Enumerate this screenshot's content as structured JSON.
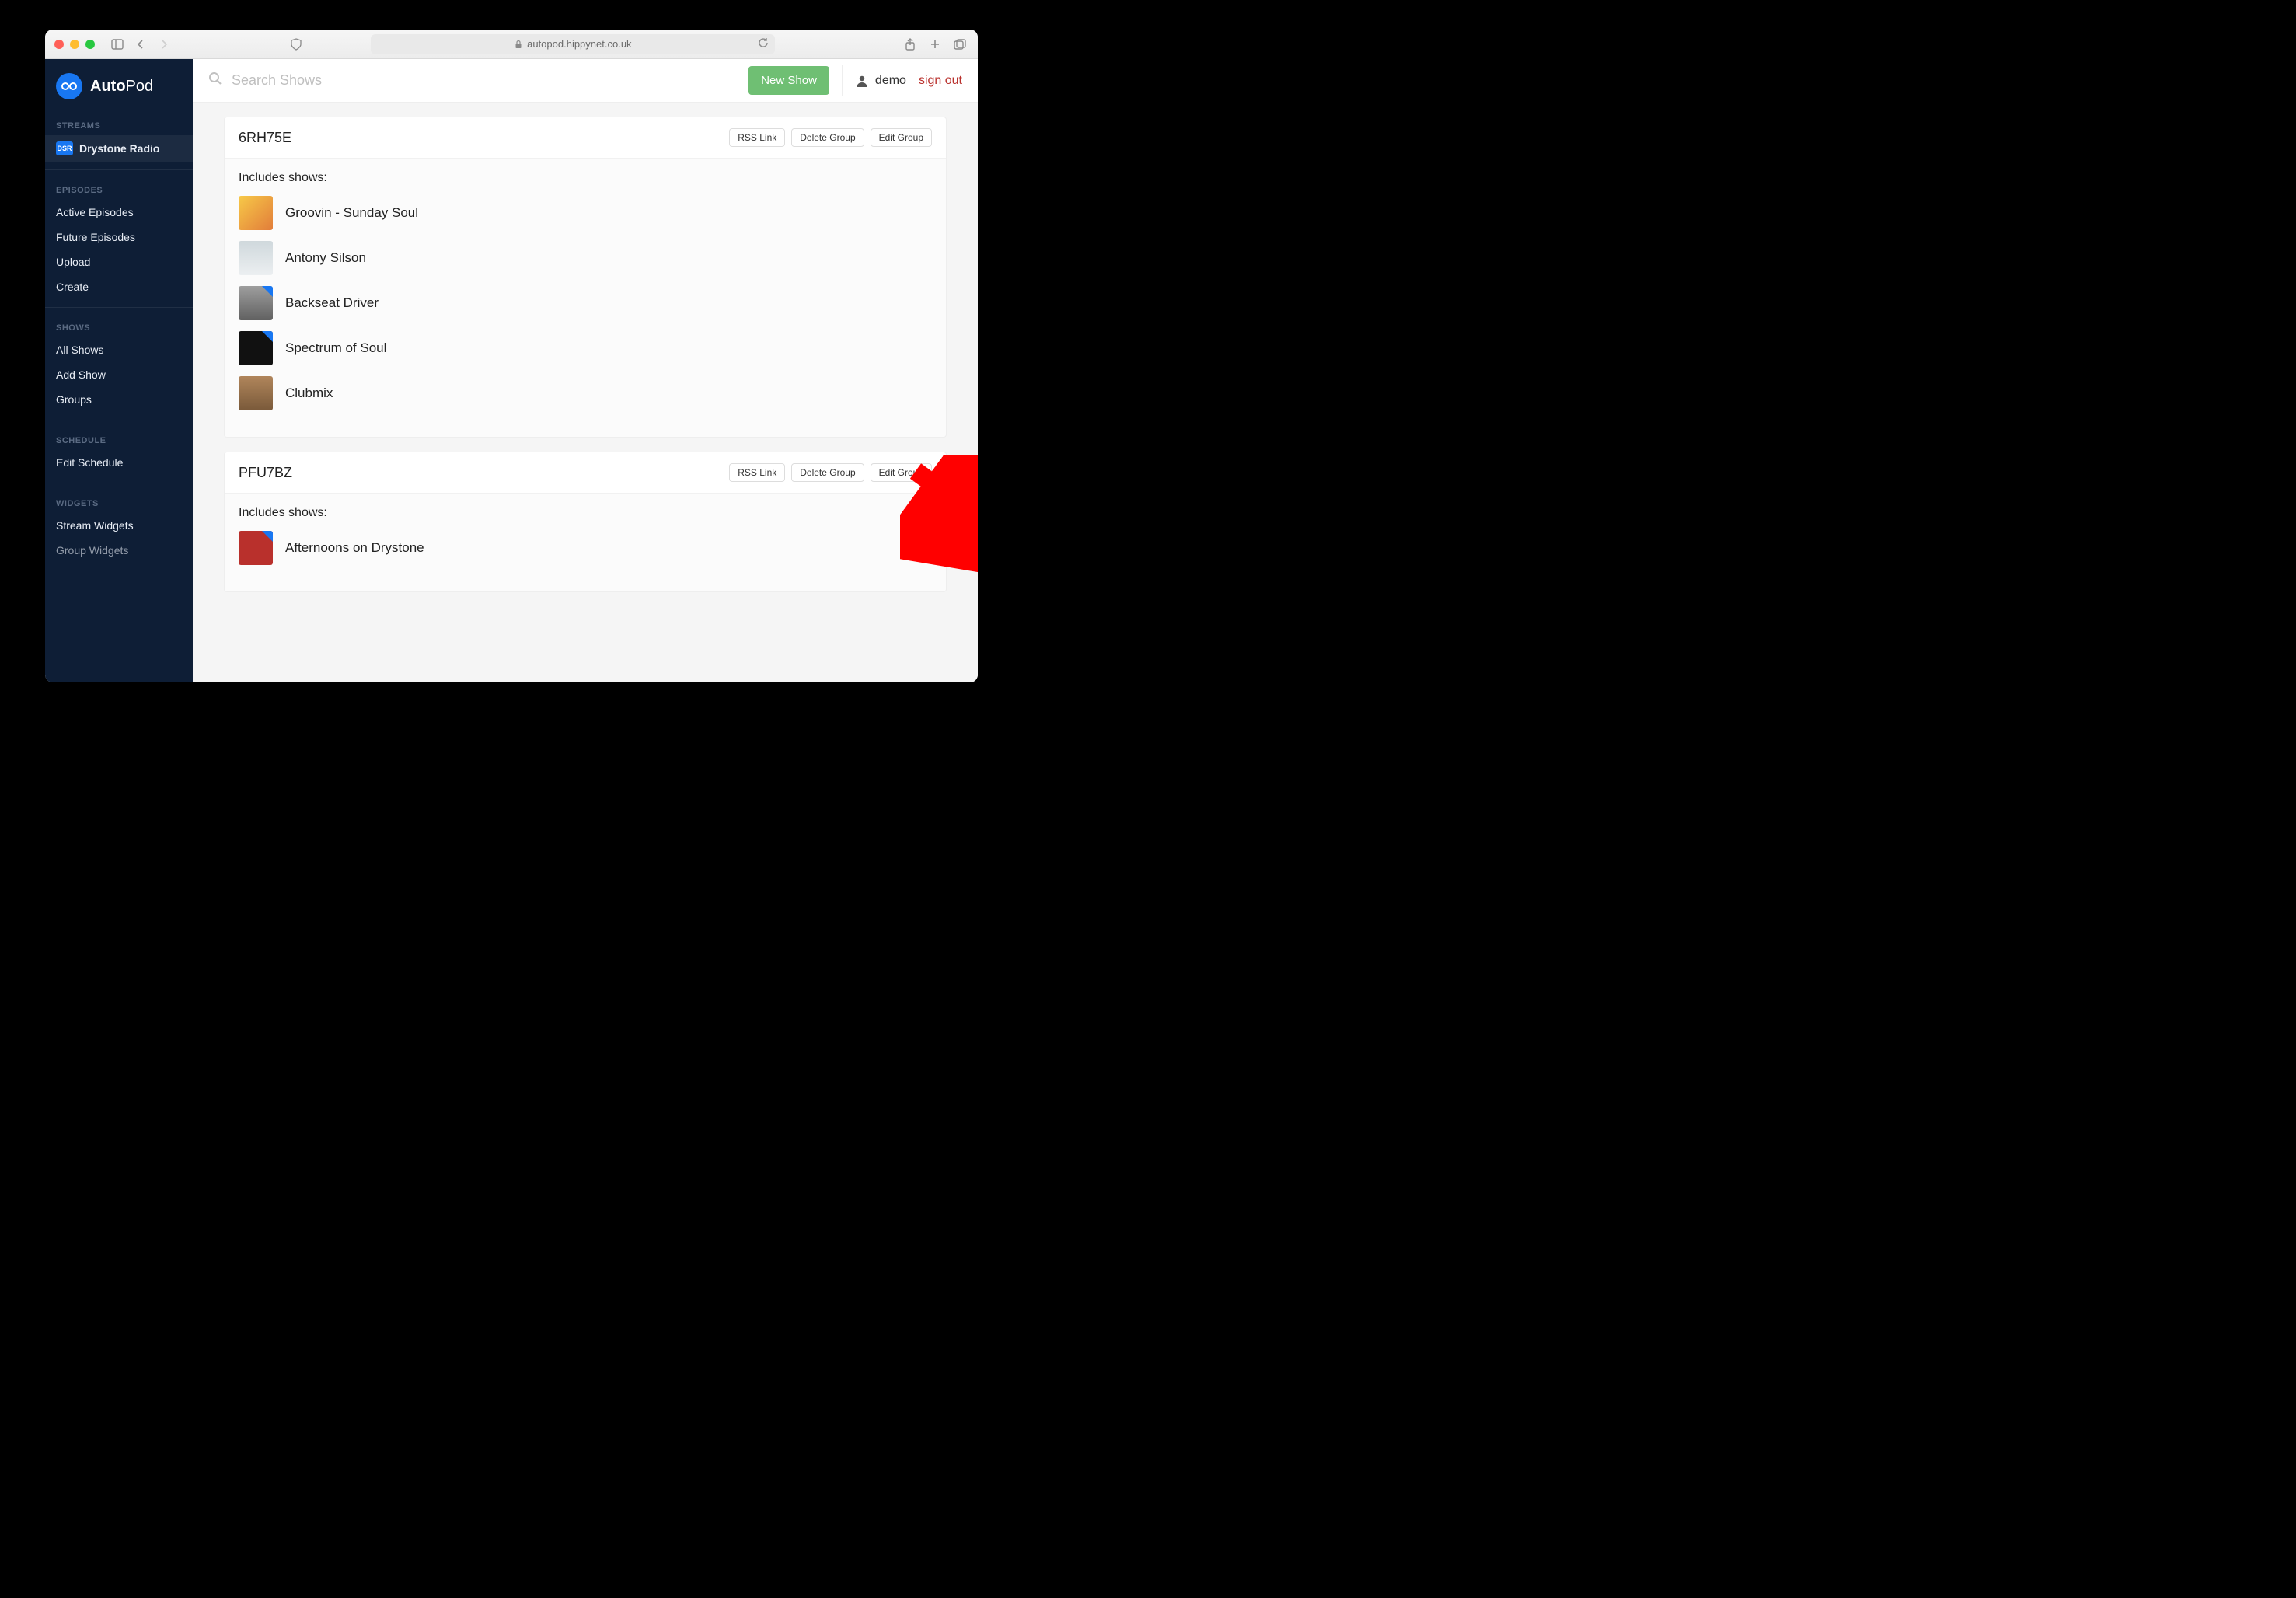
{
  "browser": {
    "url": "autopod.hippynet.co.uk"
  },
  "brand": {
    "name_a": "Auto",
    "name_b": "Pod"
  },
  "sidebar": {
    "sections": {
      "streams": {
        "label": "STREAMS",
        "active_item_chip": "DSR",
        "active_item": "Drystone Radio"
      },
      "episodes": {
        "label": "EPISODES",
        "items": [
          "Active Episodes",
          "Future Episodes",
          "Upload",
          "Create"
        ]
      },
      "shows": {
        "label": "SHOWS",
        "items": [
          "All Shows",
          "Add Show",
          "Groups"
        ]
      },
      "schedule": {
        "label": "SCHEDULE",
        "items": [
          "Edit Schedule"
        ]
      },
      "widgets": {
        "label": "WIDGETS",
        "items": [
          "Stream Widgets",
          "Group Widgets"
        ]
      }
    }
  },
  "topbar": {
    "search_placeholder": "Search Shows",
    "new_show": "New Show",
    "username": "demo",
    "signout": "sign out"
  },
  "buttons": {
    "rss": "RSS Link",
    "delete": "Delete Group",
    "edit": "Edit Group"
  },
  "includes_label": "Includes shows:",
  "groups": [
    {
      "title": "6RH75E",
      "shows": [
        {
          "name": "Groovin - Sunday Soul",
          "thumb_bg": "linear-gradient(135deg,#f7c948,#e27d3a)",
          "corner": false
        },
        {
          "name": "Antony Silson",
          "thumb_bg": "linear-gradient(#cfd8dc,#eceff1)",
          "corner": false
        },
        {
          "name": "Backseat Driver",
          "thumb_bg": "linear-gradient(#9e9e9e,#616161)",
          "corner": true
        },
        {
          "name": "Spectrum of Soul",
          "thumb_bg": "#111",
          "corner": true
        },
        {
          "name": "Clubmix",
          "thumb_bg": "linear-gradient(#b0855b,#7a5a3a)",
          "corner": false
        }
      ]
    },
    {
      "title": "PFU7BZ",
      "shows": [
        {
          "name": "Afternoons on Drystone",
          "thumb_bg": "#b9302c",
          "corner": true
        }
      ]
    }
  ]
}
